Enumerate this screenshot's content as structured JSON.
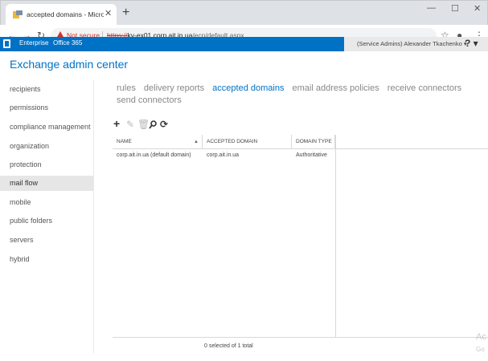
{
  "browser": {
    "tab_title": "accepted domains - Microsoft Exchange",
    "tab_close": "✕",
    "new_tab": "+",
    "window_controls": [
      "—",
      "☐",
      "✕"
    ],
    "security_label": "Not secure",
    "url_scheme": "https://",
    "url_host": "kv-ex01.corp.ait.in.ua",
    "url_path": "/ecp/default.aspx",
    "icons": [
      "back-icon",
      "forward-icon",
      "reload-icon",
      "star-icon",
      "profile-icon",
      "menu-icon"
    ]
  },
  "o365": {
    "enterprise": "Enterprise",
    "office365": "Office 365",
    "user": "(Service Admins) Alexander Tkachenko ▾",
    "help": "? ▾",
    "brand_color": "#0072c6"
  },
  "app": {
    "title": "Exchange admin center"
  },
  "leftnav": [
    "recipients",
    "permissions",
    "compliance management",
    "organization",
    "protection",
    "mail flow",
    "mobile",
    "public folders",
    "servers",
    "hybrid"
  ],
  "active_nav": "mail flow",
  "subnav": [
    "rules",
    "delivery reports",
    "accepted domains",
    "email address policies",
    "receive connectors",
    "send connectors"
  ],
  "active_subnav": "accepted domains",
  "toolbar_actions": [
    "add-icon",
    "edit-icon",
    "delete-icon",
    "search-icon",
    "refresh-icon"
  ],
  "table": {
    "columns": [
      "NAME",
      "ACCEPTED DOMAIN",
      "DOMAIN TYPE"
    ],
    "rows": [
      [
        "corp.ait.in.ua (default domain)",
        "corp.ait.in.ua",
        "Authoritative"
      ]
    ]
  },
  "footer_count": "0 selected of 1 total",
  "watermark": [
    "Ac",
    "Go"
  ]
}
